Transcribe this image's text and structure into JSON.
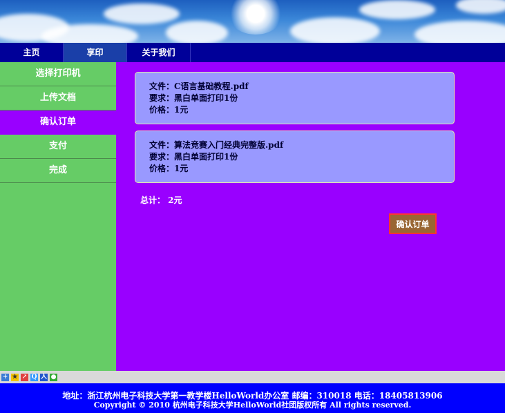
{
  "topnav": {
    "tabs": [
      {
        "label": "主页"
      },
      {
        "label": "享印"
      },
      {
        "label": "关于我们"
      }
    ]
  },
  "sidebar": {
    "items": [
      {
        "label": "选择打印机"
      },
      {
        "label": "上传文档"
      },
      {
        "label": "确认订单"
      },
      {
        "label": "支付"
      },
      {
        "label": "完成"
      }
    ]
  },
  "orders": [
    {
      "file_line": "文件：C语言基础教程.pdf",
      "req_line": "要求：黑白单面打印1份",
      "price_line": "价格：1元"
    },
    {
      "file_line": "文件：算法竞赛入门经典完整版.pdf",
      "req_line": "要求：黑白单面打印1份",
      "price_line": "价格：1元"
    }
  ],
  "total": "总计： 2元",
  "confirm_label": "确认订单",
  "footer": {
    "address": "地址：浙江杭州电子科技大学第一教学楼HelloWorld办公室 邮编：310018 电话：18405813906",
    "copyright": "Copyright © 2010 杭州电子科技大学HelloWorld社团版权所有 All rights reserved."
  },
  "icons": [
    "add-icon",
    "bookmark-star-icon",
    "share-icon",
    "qzone-icon",
    "renren-icon",
    "wechat-icon"
  ],
  "colors": {
    "nav": "#000099",
    "sidebar": "#66cc66",
    "main": "#9900ff",
    "card": "#9999ff",
    "button": "#996633",
    "footer": "#0000ff"
  }
}
